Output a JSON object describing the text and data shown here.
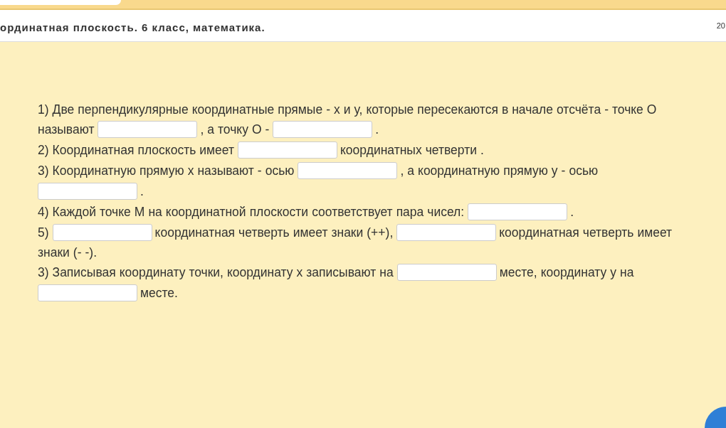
{
  "header": {
    "title": "ординатная плоскость. 6 класс, математика.",
    "corner_text": "20"
  },
  "questions": [
    {
      "parts": [
        {
          "kind": "text",
          "text": "1) Две перпендикулярные координатные прямые - x и у, которые пересекаются в начале отсчёта - точке О называют"
        },
        {
          "kind": "blank"
        },
        {
          "kind": "text",
          "text": ", а точку О -"
        },
        {
          "kind": "blank"
        },
        {
          "kind": "text",
          "text": "."
        }
      ]
    },
    {
      "parts": [
        {
          "kind": "text",
          "text": "2) Координатная плоскость имеет"
        },
        {
          "kind": "blank"
        },
        {
          "kind": "text",
          "text": "координатных четверти ."
        }
      ]
    },
    {
      "parts": [
        {
          "kind": "text",
          "text": "3) Координатную прямую х называют - осью"
        },
        {
          "kind": "blank"
        },
        {
          "kind": "text",
          "text": ", а координатную прямую у - осью"
        },
        {
          "kind": "blank"
        },
        {
          "kind": "text",
          "text": "."
        }
      ]
    },
    {
      "parts": [
        {
          "kind": "text",
          "text": "4) Каждой точке М на координатной плоскости соответствует пара чисел:"
        },
        {
          "kind": "blank"
        },
        {
          "kind": "text",
          "text": "."
        }
      ]
    },
    {
      "parts": [
        {
          "kind": "text",
          "text": "5)"
        },
        {
          "kind": "blank"
        },
        {
          "kind": "text",
          "text": "координатная четверть имеет знаки (++),"
        },
        {
          "kind": "blank"
        },
        {
          "kind": "text",
          "text": "координатная четверть имеет знаки (- -)."
        }
      ]
    },
    {
      "parts": [
        {
          "kind": "text",
          "text": "3) Записывая координату точки, координату х записывают на"
        },
        {
          "kind": "blank"
        },
        {
          "kind": "text",
          "text": "месте, координату у на"
        },
        {
          "kind": "blank"
        },
        {
          "kind": "text",
          "text": "месте."
        }
      ]
    }
  ]
}
